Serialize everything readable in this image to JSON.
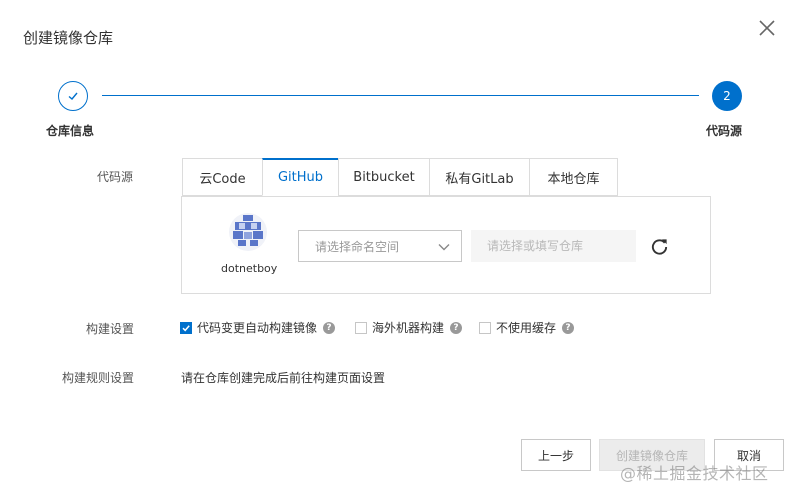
{
  "dialog": {
    "title": "创建镜像仓库"
  },
  "stepper": {
    "steps": [
      {
        "label": "仓库信息",
        "status": "done"
      },
      {
        "label": "代码源",
        "status": "current",
        "number": "2"
      }
    ],
    "accent_color": "#0070cc"
  },
  "source": {
    "label": "代码源",
    "tabs": [
      {
        "label": "云Code",
        "active": false
      },
      {
        "label": "GitHub",
        "active": true
      },
      {
        "label": "Bitbucket",
        "active": false
      },
      {
        "label": "私有GitLab",
        "active": false
      },
      {
        "label": "本地仓库",
        "active": false
      }
    ],
    "account": {
      "username": "dotnetboy"
    },
    "namespace": {
      "placeholder": "请选择命名空间"
    },
    "repository": {
      "placeholder": "请选择或填写仓库"
    }
  },
  "build_settings": {
    "label": "构建设置",
    "options": [
      {
        "label": "代码变更自动构建镜像",
        "checked": true
      },
      {
        "label": "海外机器构建",
        "checked": false
      },
      {
        "label": "不使用缓存",
        "checked": false
      }
    ]
  },
  "build_rules": {
    "label": "构建规则设置",
    "text": "请在仓库创建完成后前往构建页面设置"
  },
  "footer": {
    "prev_label": "上一步",
    "create_label": "创建镜像仓库",
    "cancel_label": "取消"
  },
  "watermark": "@稀土掘金技术社区"
}
